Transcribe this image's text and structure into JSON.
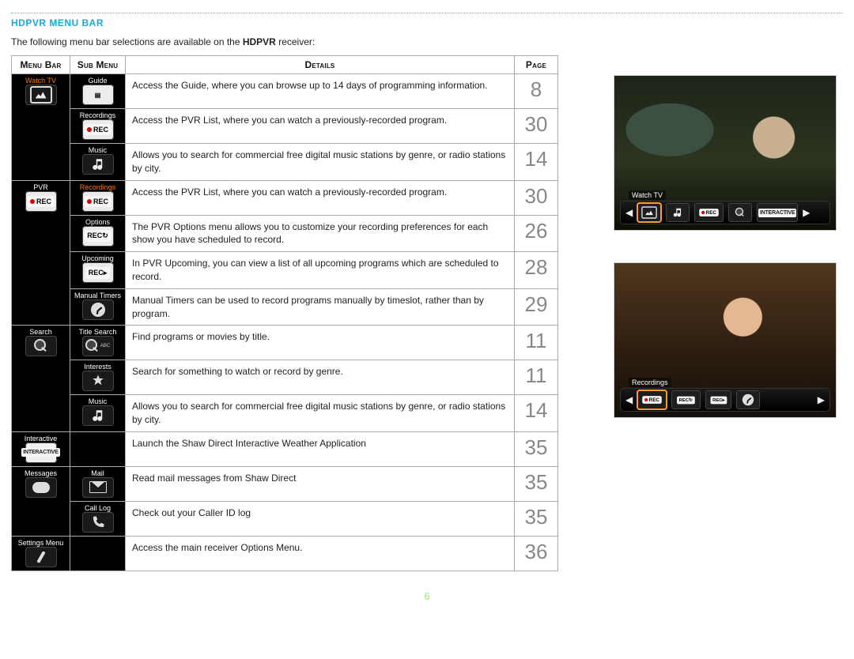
{
  "section_title": "HDPVR MENU BAR",
  "intro_pre": "The following menu bar selections are available on the ",
  "intro_bold": "HDPVR",
  "intro_post": " receiver:",
  "headers": {
    "menubar": "Menu Bar",
    "submenu": "Sub Menu",
    "details": "Details",
    "page": "Page"
  },
  "groups": [
    {
      "menu": {
        "label": "Watch TV",
        "icon": "tv",
        "highlight": true
      },
      "rows": [
        {
          "sub": {
            "label": "Guide",
            "icon": "guide"
          },
          "details": "Access the Guide, where you can browse up to 14 days of programming information.",
          "page": "8"
        },
        {
          "sub": {
            "label": "Recordings",
            "icon": "rec"
          },
          "details": "Access the PVR List, where you can watch a previously-recorded program.",
          "page": "30"
        },
        {
          "sub": {
            "label": "Music",
            "icon": "music"
          },
          "details": "Allows you to search for commercial free digital music stations by genre, or radio stations by city.",
          "page": "14"
        }
      ]
    },
    {
      "menu": {
        "label": "PVR",
        "icon": "rec-box"
      },
      "rows": [
        {
          "sub": {
            "label": "Recordings",
            "icon": "rec",
            "highlight": true
          },
          "details": "Access the PVR List, where you can watch a previously-recorded program.",
          "page": "30"
        },
        {
          "sub": {
            "label": "Options",
            "icon": "rec-options"
          },
          "details": "The PVR Options menu allows you to customize your recording preferences for each show you have scheduled to record.",
          "page": "26"
        },
        {
          "sub": {
            "label": "Upcoming",
            "icon": "rec-upcoming"
          },
          "details": "In PVR Upcoming, you can view a list of all upcoming programs which are scheduled to record.",
          "page": "28"
        },
        {
          "sub": {
            "label": "Manual Timers",
            "icon": "clock"
          },
          "details": "Manual Timers can be used to record programs manually by timeslot, rather than by program.",
          "page": "29"
        }
      ]
    },
    {
      "menu": {
        "label": "Search",
        "icon": "search"
      },
      "rows": [
        {
          "sub": {
            "label": "Title Search",
            "icon": "search-abc"
          },
          "details": "Find programs or movies by title.",
          "page": "11"
        },
        {
          "sub": {
            "label": "Interests",
            "icon": "interests"
          },
          "details": "Search for something to watch or record by genre.",
          "page": "11"
        },
        {
          "sub": {
            "label": "Music",
            "icon": "music"
          },
          "details": "Allows you to search for commercial free digital music stations by genre, or radio stations by city.",
          "page": "14"
        }
      ]
    },
    {
      "menu": {
        "label": "Interactive",
        "icon": "interactive"
      },
      "rows": [
        {
          "sub": {
            "label": "",
            "icon": ""
          },
          "details": "Launch the Shaw Direct Interactive Weather Application",
          "page": "35"
        }
      ]
    },
    {
      "menu": {
        "label": "Messages",
        "icon": "messages"
      },
      "rows": [
        {
          "sub": {
            "label": "Mail",
            "icon": "mail"
          },
          "details": "Read mail messages from Shaw Direct",
          "page": "35"
        },
        {
          "sub": {
            "label": "Call Log",
            "icon": "calllog"
          },
          "details": "Check out your Caller ID log",
          "page": "35"
        }
      ]
    },
    {
      "menu": {
        "label": "Settings Menu",
        "icon": "settings"
      },
      "rows": [
        {
          "sub": {
            "label": "",
            "icon": ""
          },
          "details": "Access the main receiver Options Menu.",
          "page": "36"
        }
      ]
    }
  ],
  "right_shots": [
    {
      "bar_label": "Watch TV",
      "tiles": [
        "tv-sel",
        "music",
        "rec",
        "search",
        "interactive"
      ]
    },
    {
      "bar_label": "Recordings",
      "tiles": [
        "rec-sel",
        "rec-options",
        "rec-upcoming",
        "clock"
      ]
    }
  ],
  "page_number": "6"
}
